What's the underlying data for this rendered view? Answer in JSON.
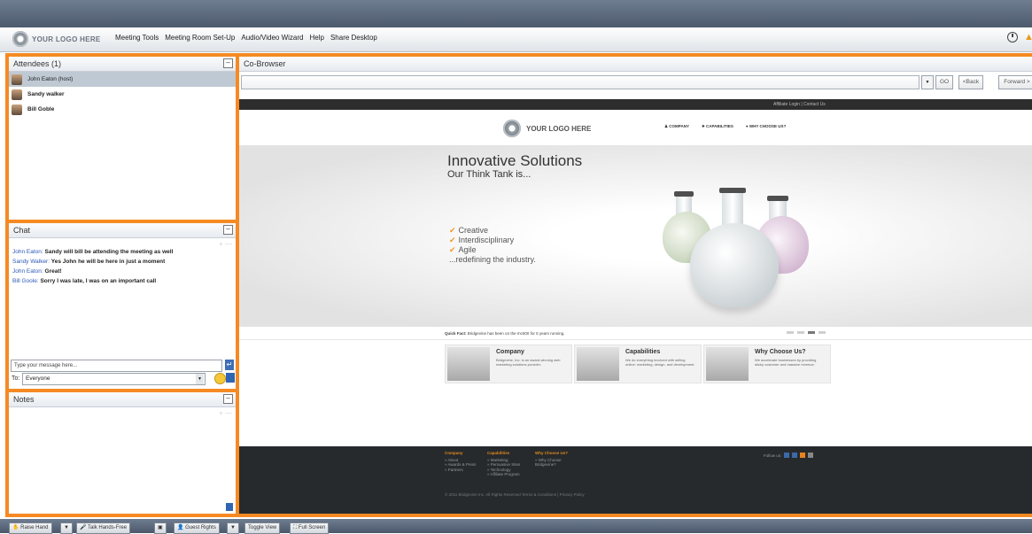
{
  "app": {
    "logo_text": "YOUR LOGO HERE",
    "menu": [
      "Meeting Tools",
      "Meeting Room Set-Up",
      "Audio/Video Wizard",
      "Help",
      "Share Desktop"
    ]
  },
  "colors": {
    "accent": "#f58a23",
    "chrome": "#55637a",
    "link": "#2d59b8"
  },
  "attendees": {
    "title": "Attendees (1)",
    "list": [
      {
        "name": "John Eaton (host)",
        "selected": true
      },
      {
        "name": "Sandy walker",
        "selected": false
      },
      {
        "name": "Bill Goble",
        "selected": false
      }
    ]
  },
  "chat": {
    "title": "Chat",
    "messages": [
      {
        "who": "John Eaton:",
        "text": "Sandy will bill be attending the meeting as well"
      },
      {
        "who": "Sandy Walker:",
        "text": "Yes John he will be here in just a moment"
      },
      {
        "who": "John Eaton:",
        "text": "Great!"
      },
      {
        "who": "Bill Goole:",
        "text": "Sorry I was late, I was on an important call"
      }
    ],
    "input_placeholder": "Type your message here...",
    "to_label": "To:",
    "to_value": "Everyone"
  },
  "notes": {
    "title": "Notes"
  },
  "cobrowser": {
    "title": "Co-Browser",
    "go_label": "GO",
    "back_label": "<Back",
    "forward_label": "Forward >"
  },
  "site": {
    "top_links": "Affiliate Login  |  Contact Us",
    "logo_text": "YOUR LOGO HERE",
    "nav": [
      "COMPANY",
      "CAPABILITIES",
      "WHY CHOOSE US?"
    ],
    "hero_title": "Innovative Solutions",
    "hero_subtitle": "Our Think Tank is...",
    "hero_list": [
      "Creative",
      "Interdisciplinary",
      "Agile"
    ],
    "hero_last": "...redefining the industry.",
    "quick_fact_label": "Quick Fact:",
    "quick_fact_text": "Bridgevine has been on the Inc500 for 5 years running.",
    "cards": [
      {
        "title": "Company",
        "text": "Bridgevine, Inc. is an award-winning web marketing solutions provider."
      },
      {
        "title": "Capabilities",
        "text": "We do everything involved with selling online: marketing, design, and development."
      },
      {
        "title": "Why Choose Us?",
        "text": "We accelerate businesses by providing sticky customer and massive revenue."
      }
    ],
    "footer": {
      "company": {
        "head": "Company",
        "items": [
          "» About",
          "» Awards & Press",
          "» Partners"
        ]
      },
      "capabilities": {
        "head": "Capabilities",
        "items": [
          "» Marketing",
          "» Persuasive Sites",
          "» Technology",
          "» Affiliate Program"
        ]
      },
      "why": {
        "head": "Why Choose Us?",
        "items": [
          "» Why Choose",
          "Bridgevine?"
        ]
      },
      "follow_label": "Follow us:",
      "copyright": "© 2011 Bridgevine Inc. All Rights Reserved    Terms & Conditions  |  Privacy Policy"
    }
  },
  "bottom": {
    "raise_hand": "Raise Hand",
    "talk": "Talk Hands-Free",
    "guest_rights": "Guest Rights",
    "toggle_view": "Toggle View",
    "full_screen": "Full Screen"
  }
}
